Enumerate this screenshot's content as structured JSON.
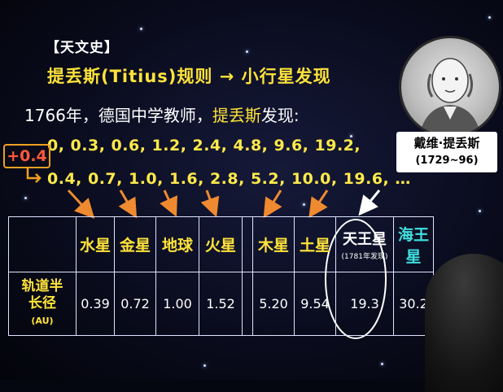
{
  "heading": {
    "tag": "【天文史】",
    "title": "提丢斯(Titius)规则 → 小行星发现"
  },
  "intro": {
    "prefix": "1766年，德国中学教师，",
    "highlight": "提丢斯",
    "suffix": "发现:"
  },
  "sequence": {
    "base": "0,   0.3,  0.6,  1.2,  2.4,  4.8,    9.6,  19.2,",
    "add_label": "+0.4",
    "result": "0.4,  0.7,  1.0,  1.6,  2.8,  5.2,  10.0,  19.6,  …"
  },
  "portrait": {
    "name": "戴维·提丢斯",
    "years": "(1729~96)"
  },
  "table": {
    "row_label_line1": "轨道半",
    "row_label_line2": "长径",
    "row_label_unit": "(AU)",
    "planets": [
      {
        "name": "水星",
        "value": "0.39"
      },
      {
        "name": "金星",
        "value": "0.72"
      },
      {
        "name": "地球",
        "value": "1.00"
      },
      {
        "name": "火星",
        "value": "1.52"
      },
      {
        "name": "",
        "value": ""
      },
      {
        "name": "木星",
        "value": "5.20"
      },
      {
        "name": "土星",
        "value": "9.54"
      },
      {
        "name": "天王星",
        "note": "(1781年发现)",
        "value": "19.3"
      },
      {
        "name": "海王星",
        "value": "30.2"
      }
    ]
  },
  "colors": {
    "yellow": "#ffe33a",
    "cyan": "#3fe0e0",
    "arrow": "#f08a30",
    "add_box": "#ff5a3a"
  }
}
